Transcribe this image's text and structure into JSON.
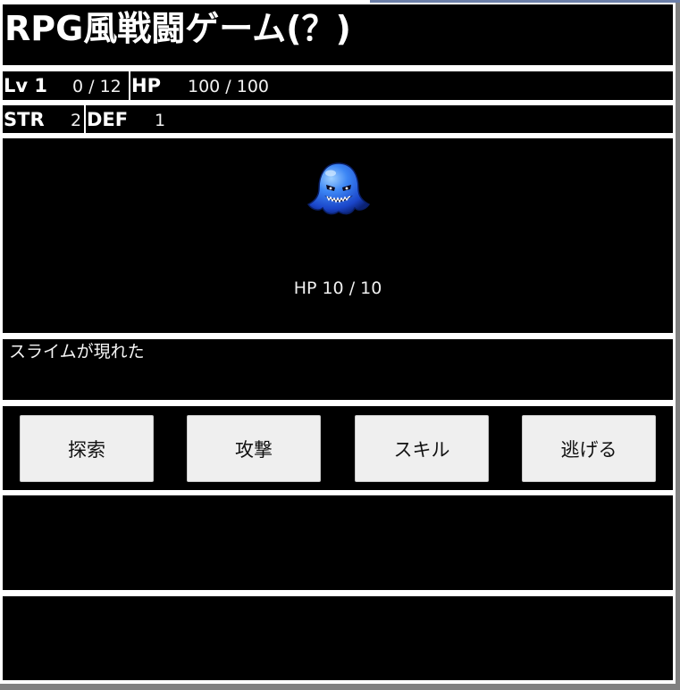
{
  "game": {
    "title": "RPG風戦闘ゲーム(？)"
  },
  "player": {
    "level_label": "Lv 1",
    "exp": "0 / 12",
    "hp_label": "HP",
    "hp": "100 / 100",
    "str_label": "STR",
    "str": "2",
    "def_label": "DEF",
    "def": "1"
  },
  "enemy": {
    "name": "スライム",
    "sprite": "blue-ghost-slime-icon",
    "hp_text": "HP 10 / 10",
    "color": "#2f6ff0"
  },
  "message": {
    "text": "スライムが現れた"
  },
  "commands": [
    {
      "label": "探索"
    },
    {
      "label": "攻撃"
    },
    {
      "label": "スキル"
    },
    {
      "label": "逃げる"
    }
  ],
  "log": {
    "panel_1": "",
    "panel_2": ""
  },
  "colors": {
    "panel_bg": "#000000",
    "panel_text": "#ffffff",
    "button_bg": "#efefef",
    "page_bg": "#ffffff"
  }
}
